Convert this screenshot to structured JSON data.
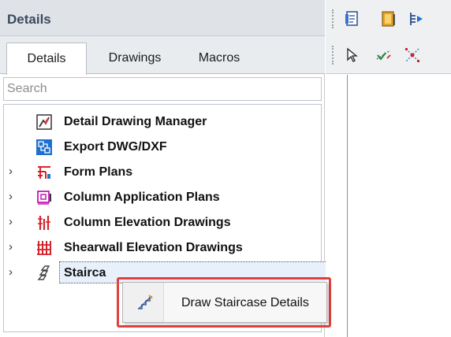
{
  "panel": {
    "title": "Details",
    "tabs": [
      {
        "label": "Details",
        "active": true
      },
      {
        "label": "Drawings",
        "active": false
      },
      {
        "label": "Macros",
        "active": false
      }
    ],
    "search": {
      "placeholder": "Search",
      "value": ""
    }
  },
  "tree": {
    "items": [
      {
        "label": "Detail Drawing Manager",
        "expandable": false,
        "icon": "drawing-manager-icon"
      },
      {
        "label": "Export DWG/DXF",
        "expandable": false,
        "icon": "export-dwg-icon"
      },
      {
        "label": "Form Plans",
        "expandable": true,
        "icon": "form-plans-icon"
      },
      {
        "label": "Column Application Plans",
        "expandable": true,
        "icon": "column-application-icon"
      },
      {
        "label": "Column Elevation Drawings",
        "expandable": true,
        "icon": "column-elevation-icon"
      },
      {
        "label": "Shearwall Elevation Drawings",
        "expandable": true,
        "icon": "shearwall-elevation-icon"
      },
      {
        "label": "Stairca",
        "expandable": true,
        "icon": "staircase-icon",
        "selected": true
      }
    ]
  },
  "context_menu": {
    "items": [
      {
        "label": "Draw Staircase Details",
        "icon": "staircase-draw-icon"
      }
    ],
    "highlight_color": "#e1403f"
  },
  "toolbar": {
    "row1_icons": [
      "sheet-icon",
      "book-icon",
      "arrow-table-icon"
    ],
    "row2_icons": [
      "pointer-icon",
      "check-line-icon",
      "dimension-icon"
    ]
  },
  "colors": {
    "header_bg": "#dfe3e8",
    "title_color": "#3b4a5e",
    "accent_red": "#e1403f"
  }
}
